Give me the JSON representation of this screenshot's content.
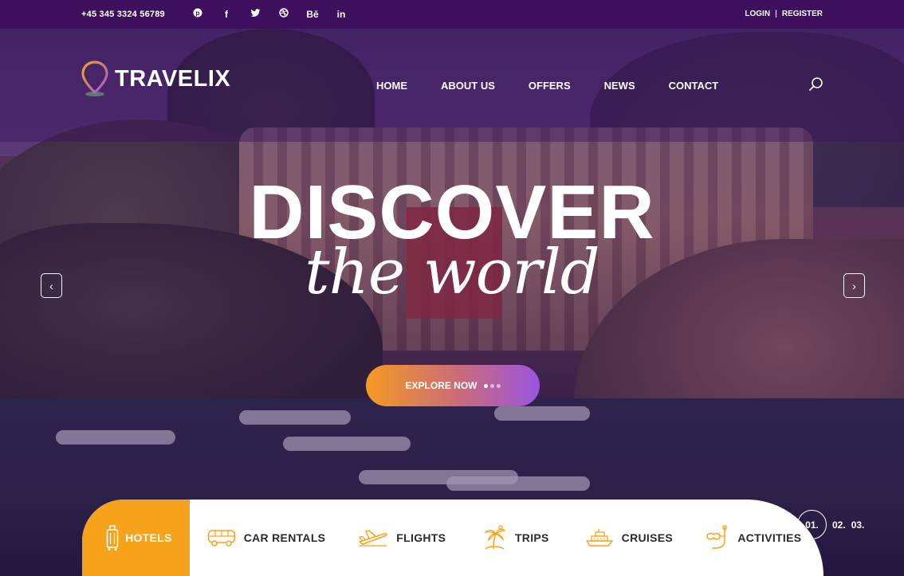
{
  "topbar": {
    "phone": "+45 345 3324 56789",
    "socials": [
      "pinterest-icon",
      "facebook-icon",
      "twitter-icon",
      "dribbble-icon",
      "behance-icon",
      "linkedin-icon"
    ],
    "social_glyphs": [
      "℗",
      "f",
      "🐦",
      "⊕",
      "Bē",
      "in"
    ],
    "login": "LOGIN",
    "separator": "|",
    "register": "REGISTER"
  },
  "header": {
    "logo_text": "TRAVELIX",
    "nav": [
      "HOME",
      "ABOUT US",
      "OFFERS",
      "NEWS",
      "CONTACT"
    ]
  },
  "hero": {
    "headline": "DISCOVER",
    "subheadline": "the world",
    "cta": "EXPLORE NOW",
    "prev_glyph": "‹",
    "next_glyph": "›"
  },
  "categories": [
    "HOTELS",
    "CAR RENTALS",
    "FLIGHTS",
    "TRIPS",
    "CRUISES",
    "ACTIVITIES"
  ],
  "slides": [
    "01.",
    "02.",
    "03."
  ],
  "colors": {
    "topbar": "#3d0f5c",
    "accent_orange": "#f7a21b",
    "accent_purple": "#9a55e0"
  }
}
